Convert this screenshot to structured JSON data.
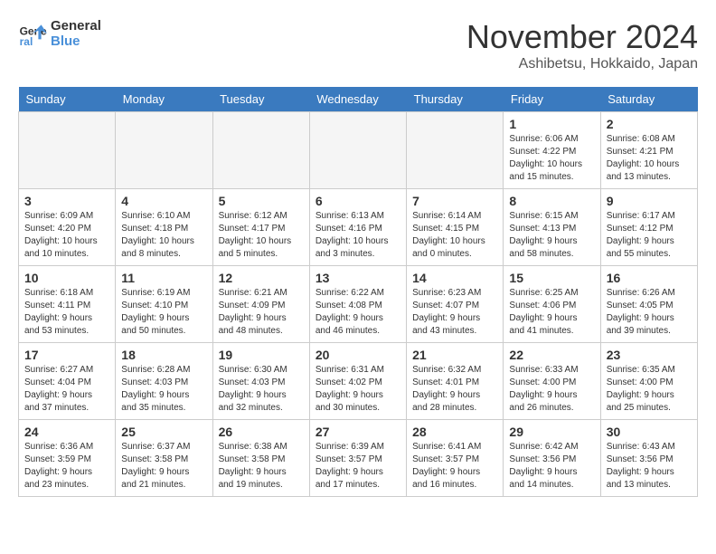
{
  "header": {
    "logo_line1": "General",
    "logo_line2": "Blue",
    "month": "November 2024",
    "location": "Ashibetsu, Hokkaido, Japan"
  },
  "weekdays": [
    "Sunday",
    "Monday",
    "Tuesday",
    "Wednesday",
    "Thursday",
    "Friday",
    "Saturday"
  ],
  "weeks": [
    [
      {
        "day": "",
        "info": ""
      },
      {
        "day": "",
        "info": ""
      },
      {
        "day": "",
        "info": ""
      },
      {
        "day": "",
        "info": ""
      },
      {
        "day": "",
        "info": ""
      },
      {
        "day": "1",
        "info": "Sunrise: 6:06 AM\nSunset: 4:22 PM\nDaylight: 10 hours\nand 15 minutes."
      },
      {
        "day": "2",
        "info": "Sunrise: 6:08 AM\nSunset: 4:21 PM\nDaylight: 10 hours\nand 13 minutes."
      }
    ],
    [
      {
        "day": "3",
        "info": "Sunrise: 6:09 AM\nSunset: 4:20 PM\nDaylight: 10 hours\nand 10 minutes."
      },
      {
        "day": "4",
        "info": "Sunrise: 6:10 AM\nSunset: 4:18 PM\nDaylight: 10 hours\nand 8 minutes."
      },
      {
        "day": "5",
        "info": "Sunrise: 6:12 AM\nSunset: 4:17 PM\nDaylight: 10 hours\nand 5 minutes."
      },
      {
        "day": "6",
        "info": "Sunrise: 6:13 AM\nSunset: 4:16 PM\nDaylight: 10 hours\nand 3 minutes."
      },
      {
        "day": "7",
        "info": "Sunrise: 6:14 AM\nSunset: 4:15 PM\nDaylight: 10 hours\nand 0 minutes."
      },
      {
        "day": "8",
        "info": "Sunrise: 6:15 AM\nSunset: 4:13 PM\nDaylight: 9 hours\nand 58 minutes."
      },
      {
        "day": "9",
        "info": "Sunrise: 6:17 AM\nSunset: 4:12 PM\nDaylight: 9 hours\nand 55 minutes."
      }
    ],
    [
      {
        "day": "10",
        "info": "Sunrise: 6:18 AM\nSunset: 4:11 PM\nDaylight: 9 hours\nand 53 minutes."
      },
      {
        "day": "11",
        "info": "Sunrise: 6:19 AM\nSunset: 4:10 PM\nDaylight: 9 hours\nand 50 minutes."
      },
      {
        "day": "12",
        "info": "Sunrise: 6:21 AM\nSunset: 4:09 PM\nDaylight: 9 hours\nand 48 minutes."
      },
      {
        "day": "13",
        "info": "Sunrise: 6:22 AM\nSunset: 4:08 PM\nDaylight: 9 hours\nand 46 minutes."
      },
      {
        "day": "14",
        "info": "Sunrise: 6:23 AM\nSunset: 4:07 PM\nDaylight: 9 hours\nand 43 minutes."
      },
      {
        "day": "15",
        "info": "Sunrise: 6:25 AM\nSunset: 4:06 PM\nDaylight: 9 hours\nand 41 minutes."
      },
      {
        "day": "16",
        "info": "Sunrise: 6:26 AM\nSunset: 4:05 PM\nDaylight: 9 hours\nand 39 minutes."
      }
    ],
    [
      {
        "day": "17",
        "info": "Sunrise: 6:27 AM\nSunset: 4:04 PM\nDaylight: 9 hours\nand 37 minutes."
      },
      {
        "day": "18",
        "info": "Sunrise: 6:28 AM\nSunset: 4:03 PM\nDaylight: 9 hours\nand 35 minutes."
      },
      {
        "day": "19",
        "info": "Sunrise: 6:30 AM\nSunset: 4:03 PM\nDaylight: 9 hours\nand 32 minutes."
      },
      {
        "day": "20",
        "info": "Sunrise: 6:31 AM\nSunset: 4:02 PM\nDaylight: 9 hours\nand 30 minutes."
      },
      {
        "day": "21",
        "info": "Sunrise: 6:32 AM\nSunset: 4:01 PM\nDaylight: 9 hours\nand 28 minutes."
      },
      {
        "day": "22",
        "info": "Sunrise: 6:33 AM\nSunset: 4:00 PM\nDaylight: 9 hours\nand 26 minutes."
      },
      {
        "day": "23",
        "info": "Sunrise: 6:35 AM\nSunset: 4:00 PM\nDaylight: 9 hours\nand 25 minutes."
      }
    ],
    [
      {
        "day": "24",
        "info": "Sunrise: 6:36 AM\nSunset: 3:59 PM\nDaylight: 9 hours\nand 23 minutes."
      },
      {
        "day": "25",
        "info": "Sunrise: 6:37 AM\nSunset: 3:58 PM\nDaylight: 9 hours\nand 21 minutes."
      },
      {
        "day": "26",
        "info": "Sunrise: 6:38 AM\nSunset: 3:58 PM\nDaylight: 9 hours\nand 19 minutes."
      },
      {
        "day": "27",
        "info": "Sunrise: 6:39 AM\nSunset: 3:57 PM\nDaylight: 9 hours\nand 17 minutes."
      },
      {
        "day": "28",
        "info": "Sunrise: 6:41 AM\nSunset: 3:57 PM\nDaylight: 9 hours\nand 16 minutes."
      },
      {
        "day": "29",
        "info": "Sunrise: 6:42 AM\nSunset: 3:56 PM\nDaylight: 9 hours\nand 14 minutes."
      },
      {
        "day": "30",
        "info": "Sunrise: 6:43 AM\nSunset: 3:56 PM\nDaylight: 9 hours\nand 13 minutes."
      }
    ]
  ]
}
